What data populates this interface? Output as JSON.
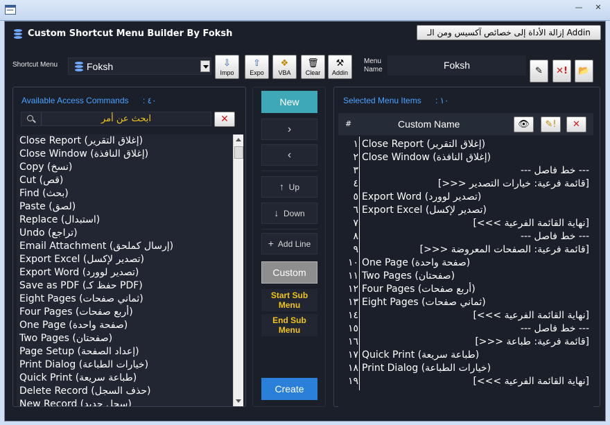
{
  "app": {
    "title": "Custom Shortcut Menu Builder By Foksh",
    "remove_button": "إزالة الأداة إلى خصائص آكسيس ومن الـ Addin"
  },
  "toolbar": {
    "shortcut_label": "Shortcut Menu",
    "shortcut_value": "Foksh",
    "buttons": [
      {
        "label": "Impo",
        "icon": "import-icon"
      },
      {
        "label": "Expo",
        "icon": "export-icon"
      },
      {
        "label": "VBA",
        "icon": "vba-icon"
      },
      {
        "label": "Clear",
        "icon": "trash-icon"
      },
      {
        "label": "Addin",
        "icon": "tools-icon"
      }
    ],
    "menu_name_label": [
      "Menu",
      "Name"
    ],
    "menu_name_value": "Foksh"
  },
  "left": {
    "title": "Available Access Commands",
    "count": ": ٤٠",
    "search_placeholder": "ابحث عن أمر",
    "items": [
      "Close Report (إغلاق التقرير)",
      "Close Window (إغلاق النافذة)",
      "Copy (نسخ)",
      "Cut (قص)",
      "Find (بحث)",
      "Paste (لصق)",
      "Replace (استبدال)",
      "Undo (تراجع)",
      "Email Attachment (إرسال كملحق)",
      "Export Excel (تصدير لإكسل)",
      "Export Word (تصدير لوورد)",
      "Save as PDF (حفظ كـ PDF)",
      "Eight Pages (ثماني صفحات)",
      "Four Pages (أربع صفحات)",
      "One Page (صفحة واحدة)",
      "Two Pages (صفحتان)",
      "Page Setup (إعداد الصفحة)",
      "Print Dialog (خيارات الطباعة)",
      "Quick Print (طباعة سريعة)",
      "Delete Record (حذف السجل)",
      "New Record (سجل جديد)"
    ]
  },
  "middle": {
    "new": "New",
    "move_right": "›",
    "move_left": "‹",
    "up": "Up",
    "down": "Down",
    "add_line": "Add Line",
    "custom": "Custom",
    "start_sub": [
      "Start Sub",
      "Menu"
    ],
    "end_sub": [
      "End Sub",
      "Menu"
    ],
    "create": "Create"
  },
  "right": {
    "title": "Selected Menu Items",
    "count": ": ١٠",
    "col_hash": "#",
    "col_name": "Custom Name",
    "rows": [
      {
        "n": "١",
        "t": "Close Report (إغلاق التقرير)",
        "r": false
      },
      {
        "n": "٢",
        "t": "Close Window (إغلاق النافذة)",
        "r": false
      },
      {
        "n": "٣",
        "t": "--- خط فاصل ---",
        "r": true
      },
      {
        "n": "٤",
        "t": "[>>> قائمة فرعية: خيارات التصدير]",
        "r": true
      },
      {
        "n": "٥",
        "t": "Export Word (تصدير لوورد)",
        "r": false
      },
      {
        "n": "٦",
        "t": "Export Excel (تصدير لإكسل)",
        "r": false
      },
      {
        "n": "٧",
        "t": "[<<< نهاية القائمة الفرعية]",
        "r": true
      },
      {
        "n": "٨",
        "t": "--- خط فاصل ---",
        "r": true
      },
      {
        "n": "٩",
        "t": "[>>> قائمة فرعية: الصفحات المعروضة]",
        "r": true
      },
      {
        "n": "١٠",
        "t": "One Page (صفحة واحدة)",
        "r": false
      },
      {
        "n": "١١",
        "t": "Two Pages (صفحتان)",
        "r": false
      },
      {
        "n": "١٢",
        "t": "Four Pages (أربع صفحات)",
        "r": false
      },
      {
        "n": "١٣",
        "t": "Eight Pages (ثماني صفحات)",
        "r": false
      },
      {
        "n": "١٤",
        "t": "[<<< نهاية القائمة الفرعية]",
        "r": true
      },
      {
        "n": "١٥",
        "t": "--- خط فاصل ---",
        "r": true
      },
      {
        "n": "١٦",
        "t": "[>>> قائمة فرعية: طباعة]",
        "r": true
      },
      {
        "n": "١٧",
        "t": "Quick Print (طباعة سريعة)",
        "r": false
      },
      {
        "n": "١٨",
        "t": "Print Dialog (خيارات الطباعة)",
        "r": false
      },
      {
        "n": "١٩",
        "t": "[<<< نهاية القائمة الفرعية]",
        "r": true
      }
    ]
  },
  "colors": {
    "accent": "#4aa3ff",
    "new": "#3fa8b8",
    "create": "#2a7fd8",
    "sub": "#f0c419",
    "panel": "#1b1f2a"
  }
}
